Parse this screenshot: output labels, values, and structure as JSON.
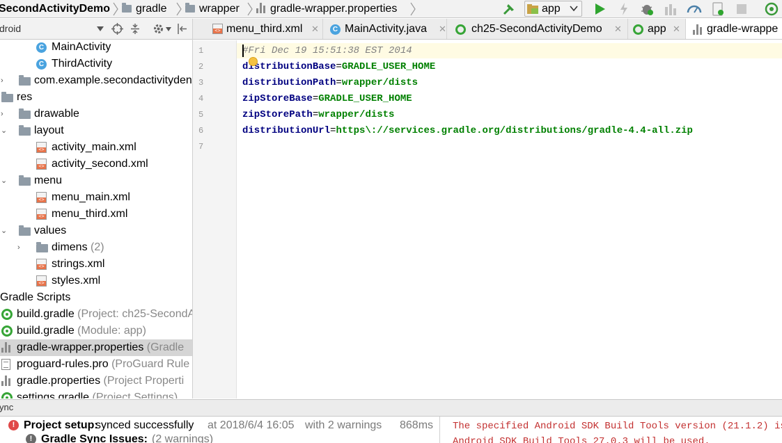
{
  "breadcrumbs": [
    {
      "label": "SecondActivityDemo",
      "icon": "none"
    },
    {
      "label": "gradle",
      "icon": "folder-icon"
    },
    {
      "label": "wrapper",
      "icon": "folder-icon"
    },
    {
      "label": "gradle-wrapper.properties",
      "icon": "properties-file-icon"
    }
  ],
  "toolbar": {
    "run_config": "app",
    "buttons": [
      "build-hammer-icon",
      "run-icon",
      "apply-changes-icon",
      "debug-icon",
      "attach-debugger-icon",
      "profile-icon",
      "stop-icon",
      "sdk-manager-icon"
    ]
  },
  "project_panel": {
    "view_selector": "droid",
    "rows": [
      {
        "label": "MainActivity",
        "suffix": "",
        "icon": "java-class-icon",
        "toggle": ""
      },
      {
        "label": "ThirdActivity",
        "suffix": "",
        "icon": "java-class-icon",
        "toggle": ""
      },
      {
        "label": "com.example.secondactivityden",
        "suffix": "",
        "icon": "package-folder-icon",
        "toggle": "›"
      },
      {
        "label": "res",
        "suffix": "",
        "icon": "res-folder-icon",
        "toggle": ""
      },
      {
        "label": "drawable",
        "suffix": "",
        "icon": "folder-icon",
        "toggle": "›"
      },
      {
        "label": "layout",
        "suffix": "",
        "icon": "folder-icon",
        "toggle": "⌄"
      },
      {
        "label": "activity_main.xml",
        "suffix": "",
        "icon": "xml-file-icon",
        "toggle": ""
      },
      {
        "label": "activity_second.xml",
        "suffix": "",
        "icon": "xml-file-icon",
        "toggle": ""
      },
      {
        "label": "menu",
        "suffix": "",
        "icon": "folder-icon",
        "toggle": "⌄"
      },
      {
        "label": "menu_main.xml",
        "suffix": "",
        "icon": "xml-file-icon",
        "toggle": ""
      },
      {
        "label": "menu_third.xml",
        "suffix": "",
        "icon": "xml-file-icon",
        "toggle": ""
      },
      {
        "label": "values",
        "suffix": "",
        "icon": "folder-icon",
        "toggle": "⌄"
      },
      {
        "label": "dimens",
        "suffix": " (2)",
        "icon": "folder-icon",
        "toggle": "›"
      },
      {
        "label": "strings.xml",
        "suffix": "",
        "icon": "xml-file-icon",
        "toggle": ""
      },
      {
        "label": "styles.xml",
        "suffix": "",
        "icon": "xml-file-icon",
        "toggle": ""
      },
      {
        "label": "Gradle Scripts",
        "suffix": "",
        "icon": "none",
        "toggle": ""
      },
      {
        "label": "build.gradle",
        "suffix": " (Project: ch25-SecondA",
        "icon": "gradle-icon",
        "toggle": ""
      },
      {
        "label": "build.gradle",
        "suffix": " (Module: app)",
        "icon": "gradle-icon",
        "toggle": ""
      },
      {
        "label": "gradle-wrapper.properties",
        "suffix": " (Gradle",
        "icon": "properties-file-icon",
        "toggle": ""
      },
      {
        "label": "proguard-rules.pro",
        "suffix": " (ProGuard Rule",
        "icon": "text-file-icon",
        "toggle": ""
      },
      {
        "label": "gradle.properties",
        "suffix": " (Project Properti",
        "icon": "properties-file-icon",
        "toggle": ""
      },
      {
        "label": "settings.gradle",
        "suffix": " (Project Settings)",
        "icon": "gradle-icon",
        "toggle": ""
      }
    ]
  },
  "tabs": [
    {
      "label": "menu_third.xml",
      "icon": "xml-file-icon"
    },
    {
      "label": "MainActivity.java",
      "icon": "java-class-icon"
    },
    {
      "label": "ch25-SecondActivityDemo",
      "icon": "gradle-icon"
    },
    {
      "label": "app",
      "icon": "gradle-icon"
    },
    {
      "label": "gradle-wrappe",
      "icon": "properties-file-icon"
    }
  ],
  "editor": {
    "line_numbers": [
      "1",
      "2",
      "3",
      "4",
      "5",
      "6",
      "7"
    ],
    "comment": "#Fri Dec 19 15:51:38 EST 2014",
    "properties": [
      {
        "key": "distributionBase",
        "value": "GRADLE_USER_HOME"
      },
      {
        "key": "distributionPath",
        "value": "wrapper/dists"
      },
      {
        "key": "zipStoreBase",
        "value": "GRADLE_USER_HOME"
      },
      {
        "key": "zipStorePath",
        "value": "wrapper/dists"
      },
      {
        "key": "distributionUrl",
        "value": "https\\://services.gradle.org/distributions/gradle-4.4-all.zip"
      }
    ]
  },
  "status_bar": {
    "tab_label": "ync"
  },
  "build": {
    "setup": {
      "title": "Project setup:",
      "message": " synced successfully",
      "time": "at 2018/6/4 16:05",
      "warnings": "with 2 warnings",
      "duration": "868ms"
    },
    "issues": {
      "title": "Gradle Sync Issues:",
      "count": "(2 warnings)"
    },
    "output": [
      "The specified Android SDK Build Tools version (21.1.2) is i",
      "Android SDK Build Tools 27.0.3 will be used."
    ]
  },
  "colors": {
    "accent_green": "#37a537",
    "key_navy": "#000080",
    "value_green": "#008000",
    "error_red": "#c33030"
  }
}
